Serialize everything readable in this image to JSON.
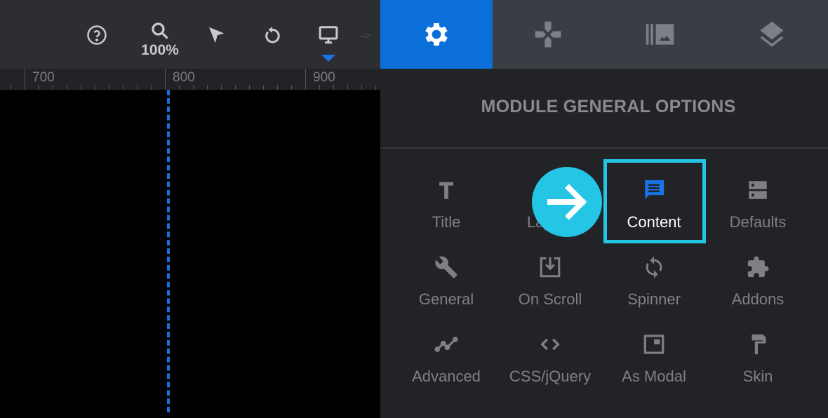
{
  "toolbar": {
    "buttons": [
      {
        "name": "help",
        "icon": "help-circle-icon"
      },
      {
        "name": "zoom",
        "icon": "search-icon"
      },
      {
        "name": "select",
        "icon": "cursor-arrow-icon"
      },
      {
        "name": "undo",
        "icon": "undo-icon"
      },
      {
        "name": "device-desktop",
        "icon": "monitor-icon"
      }
    ],
    "zoom_level": "100%",
    "arrow_hint": "-->"
  },
  "ruler": {
    "labels": [
      "700",
      "800",
      "900"
    ]
  },
  "tabs": [
    {
      "name": "settings",
      "icon": "gear-icon",
      "active": true
    },
    {
      "name": "controls",
      "icon": "gamepad-icon",
      "active": false
    },
    {
      "name": "media",
      "icon": "gallery-icon",
      "active": false
    },
    {
      "name": "layers",
      "icon": "layers-icon",
      "active": false
    }
  ],
  "panel": {
    "title": "MODULE GENERAL OPTIONS",
    "options": [
      {
        "label": "Title",
        "icon": "text-icon"
      },
      {
        "label": "Layout",
        "icon": "layout-icon"
      },
      {
        "label": "Content",
        "icon": "chat-message-icon",
        "selected": true
      },
      {
        "label": "Defaults",
        "icon": "server-icon"
      },
      {
        "label": "General",
        "icon": "wrench-icon"
      },
      {
        "label": "On Scroll",
        "icon": "download-box-icon"
      },
      {
        "label": "Spinner",
        "icon": "sync-icon"
      },
      {
        "label": "Addons",
        "icon": "puzzle-icon"
      },
      {
        "label": "Advanced",
        "icon": "trend-line-icon"
      },
      {
        "label": "CSS/jQuery",
        "icon": "code-icon"
      },
      {
        "label": "As Modal",
        "icon": "modal-window-icon"
      },
      {
        "label": "Skin",
        "icon": "paint-roller-icon"
      }
    ]
  },
  "colors": {
    "accent": "#0a6fd9",
    "highlight": "#25c5e6",
    "panel_bg": "#222326",
    "toolbar_bg": "#2d2e33"
  }
}
